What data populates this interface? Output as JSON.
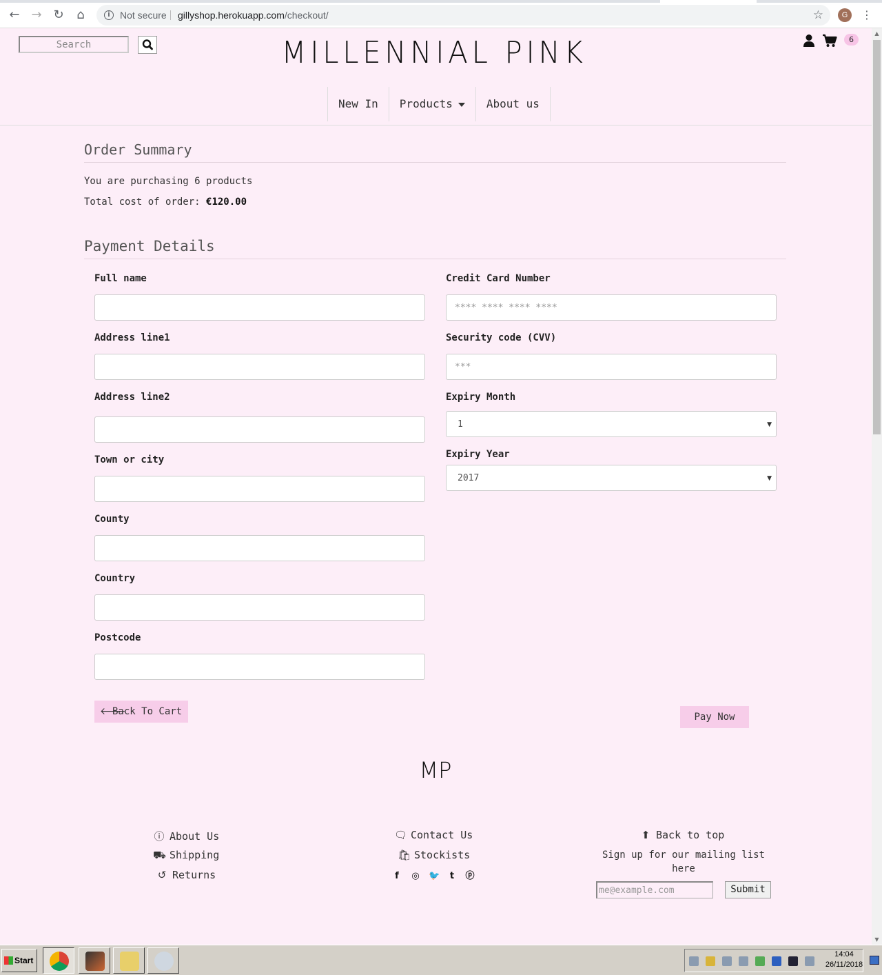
{
  "browser": {
    "security_label": "Not secure",
    "url_host": "gillyshop.herokuapp.com",
    "url_path": "/checkout/",
    "profile_initial": "G"
  },
  "header": {
    "search_placeholder": "Search",
    "logo_text": "MILLENNIAL PINK",
    "cart_count": "6",
    "nav": [
      {
        "label": "New In"
      },
      {
        "label": "Products"
      },
      {
        "label": "About us"
      }
    ]
  },
  "summary": {
    "title": "Order Summary",
    "purchasing_text": "You are purchasing 6 products",
    "total_label": "Total cost of order:",
    "total_value": "€120.00"
  },
  "payment": {
    "title": "Payment Details",
    "left_fields": [
      {
        "label": "Full name",
        "value": ""
      },
      {
        "label": "Address line1",
        "value": ""
      },
      {
        "label": "Address line2",
        "value": ""
      },
      {
        "label": "Town or city",
        "value": ""
      },
      {
        "label": "County",
        "value": ""
      },
      {
        "label": "Country",
        "value": ""
      },
      {
        "label": "Postcode",
        "value": ""
      }
    ],
    "card_number_label": "Credit Card Number",
    "card_number_placeholder": "**** **** **** ****",
    "cvv_label": "Security code (CVV)",
    "cvv_placeholder": "***",
    "expiry_month_label": "Expiry Month",
    "expiry_month_value": "1",
    "expiry_year_label": "Expiry Year",
    "expiry_year_value": "2017",
    "back_label": "Back To Cart",
    "pay_label": "Pay Now"
  },
  "footer": {
    "logo_text": "MP",
    "about": "About Us",
    "shipping": "Shipping",
    "returns": "Returns",
    "contact": "Contact Us",
    "stockists": "Stockists",
    "back_to_top": "Back to top",
    "signup_text": "Sign up for our mailing list here",
    "email_placeholder": "me@example.com",
    "submit_label": "Submit"
  },
  "taskbar": {
    "start_label": "Start",
    "time": "14:04",
    "date": "26/11/2018"
  }
}
